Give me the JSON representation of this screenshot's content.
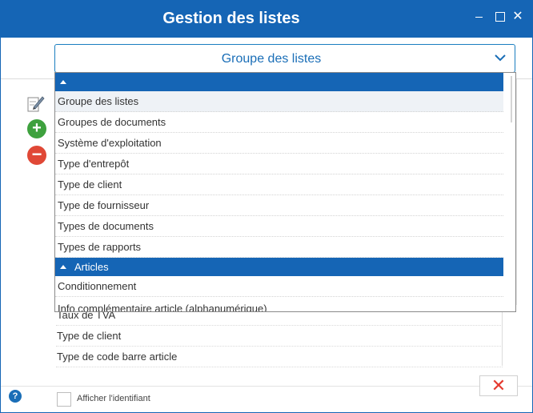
{
  "window": {
    "title": "Gestion des listes",
    "minimize_icon": "minimize-icon",
    "maximize_icon": "maximize-icon",
    "close_icon": "close-icon",
    "close_glyph": "✕",
    "accent_color": "#1565b5"
  },
  "selector": {
    "value": "Groupe des listes",
    "chevron_icon": "chevron-down-icon"
  },
  "tools": {
    "edit_icon": "edit-icon",
    "add_icon": "add-icon",
    "add_glyph": "+",
    "remove_icon": "remove-icon",
    "remove_glyph": "−"
  },
  "dropdown": {
    "groups": [
      {
        "label": "",
        "items": [
          "Groupe des listes",
          "Groupes de documents",
          "Système d'exploitation",
          "Type d'entrepôt",
          "Type de client",
          "Type de fournisseur",
          "Types de documents",
          "Types de rapports"
        ]
      },
      {
        "label": "Articles",
        "items": [
          "Conditionnement",
          "Info complémentaire article (alphanumérique)"
        ]
      }
    ],
    "selected_item": "Groupe des listes"
  },
  "background_list": {
    "items": [
      "Taux de TVA",
      "Type de client",
      "Type de code barre article"
    ]
  },
  "footer": {
    "help_glyph": "?",
    "show_identifier_label": "Afficher l'identifiant",
    "show_identifier_checked": false,
    "close_glyph": "✕"
  }
}
